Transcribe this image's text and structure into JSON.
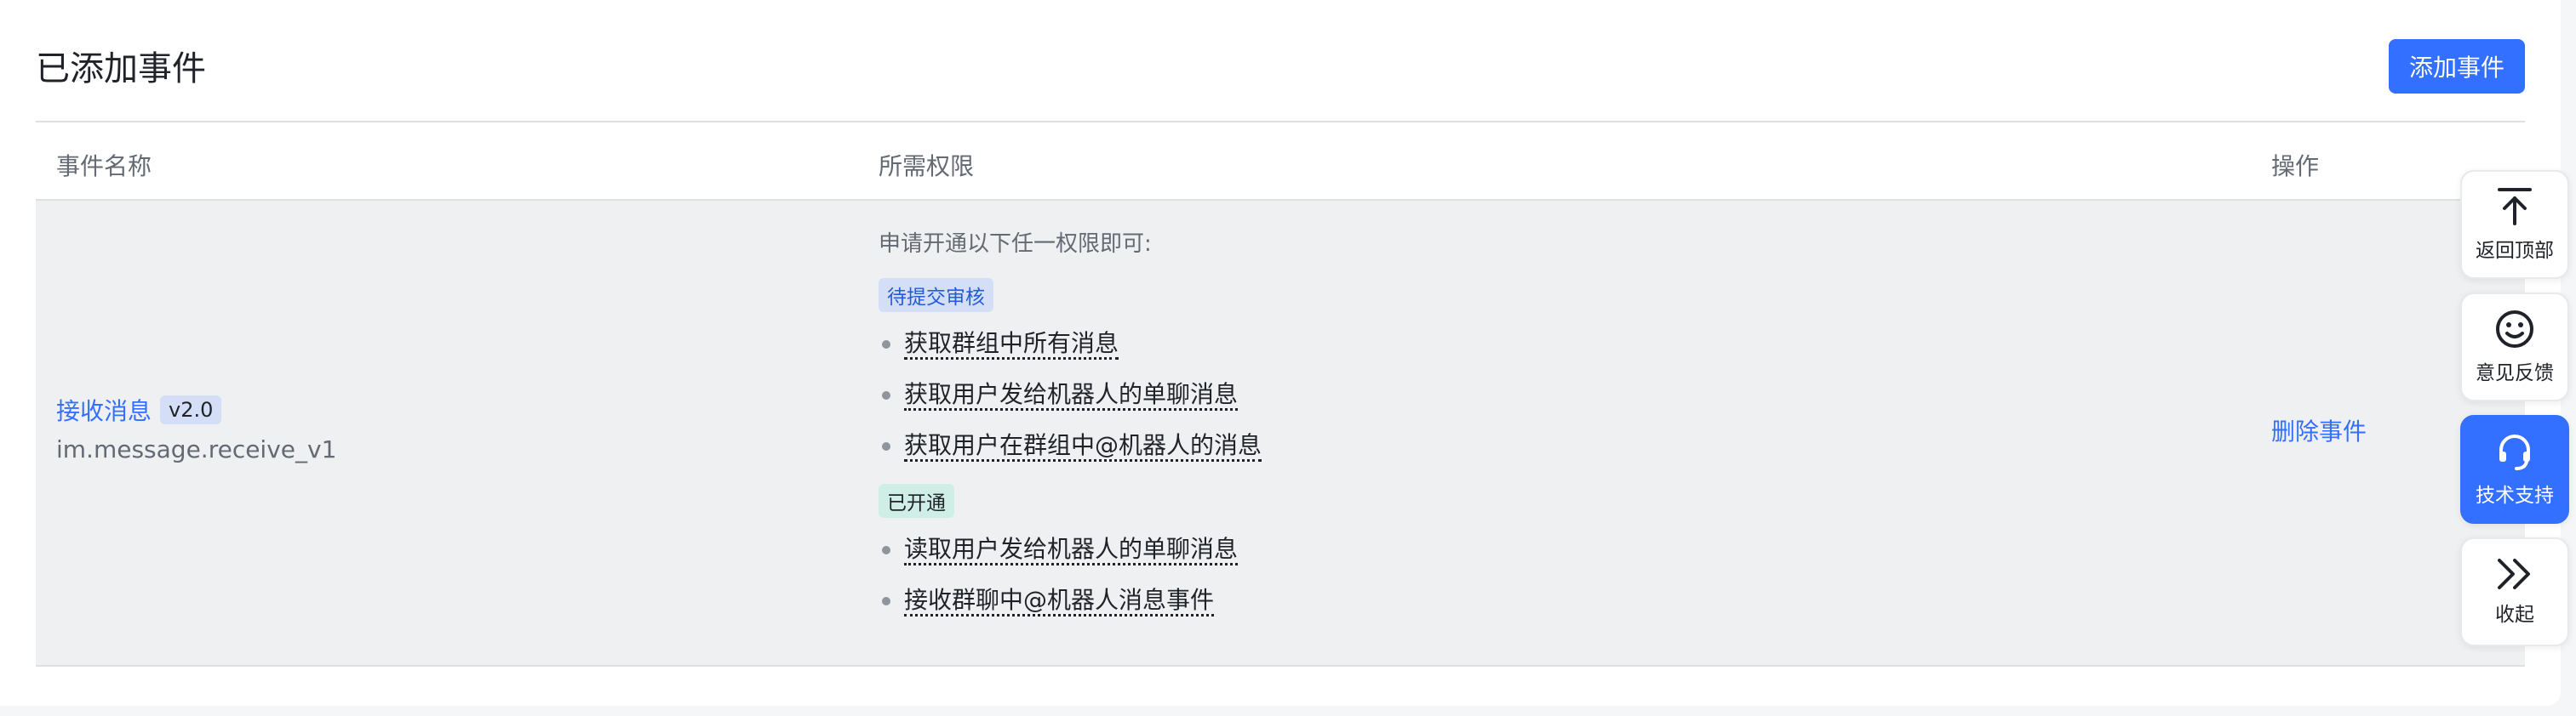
{
  "card": {
    "title": "已添加事件",
    "add_button": "添加事件"
  },
  "table": {
    "headers": [
      "事件名称",
      "所需权限",
      "操作"
    ],
    "row": {
      "event_name": "接收消息",
      "event_version": "v2.0",
      "event_id": "im.message.receive_v1",
      "permission_intro": "申请开通以下任一权限即可:",
      "pending_tag": "待提交审核",
      "pending_permissions": [
        "获取群组中所有消息",
        "获取用户发给机器人的单聊消息",
        "获取用户在群组中@机器人的消息"
      ],
      "enabled_tag": "已开通",
      "enabled_permissions": [
        "读取用户发给机器人的单聊消息",
        "接收群聊中@机器人消息事件"
      ],
      "action": "删除事件"
    }
  },
  "float_bar": {
    "back_to_top": "返回顶部",
    "feedback": "意见反馈",
    "support": "技术支持",
    "collapse": "收起"
  },
  "colors": {
    "accent": "#3370ff",
    "row_bg": "#eff0f1",
    "pending_bg": "#d4dff7",
    "enabled_bg": "#cfeee6"
  },
  "icons": [
    "arrow-up-to-top-icon",
    "smiley-face-icon",
    "headset-icon",
    "double-chevron-right-icon"
  ]
}
